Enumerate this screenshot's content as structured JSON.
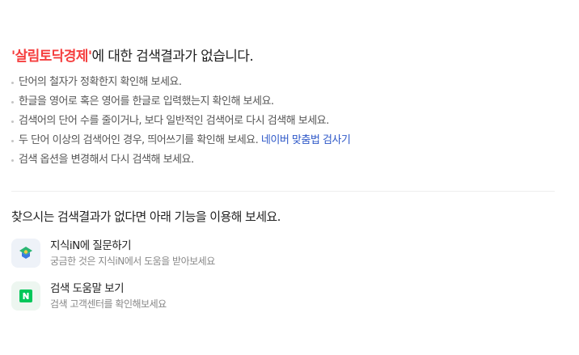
{
  "headline": {
    "query_display": "'살림토닥경제'",
    "suffix": "에 대한 검색결과가 없습니다."
  },
  "tips": [
    "단어의 철자가 정확한지 확인해 보세요.",
    "한글을 영어로 혹은 영어를 한글로 입력했는지 확인해 보세요.",
    "검색어의 단어 수를 줄이거나, 보다 일반적인 검색어로 다시 검색해 보세요.",
    "두 단어 이상의 검색어인 경우, 띄어쓰기를 확인해 보세요.",
    "검색 옵션을 변경해서 다시 검색해 보세요."
  ],
  "spell_link": "네이버 맞춤법 검사기",
  "alt_heading": "찾으시는 검색결과가 없다면 아래 기능을 이용해 보세요.",
  "features": [
    {
      "title": "지식iN에 질문하기",
      "desc": "궁금한 것은 지식iN에서 도움을 받아보세요",
      "icon": "kin-icon"
    },
    {
      "title": "검색 도움말 보기",
      "desc": "검색 고객센터를 확인해보세요",
      "icon": "naver-n-icon"
    }
  ],
  "colors": {
    "query_highlight": "#f53e3e",
    "link": "#2e58c8",
    "naver_green": "#03c75a"
  }
}
